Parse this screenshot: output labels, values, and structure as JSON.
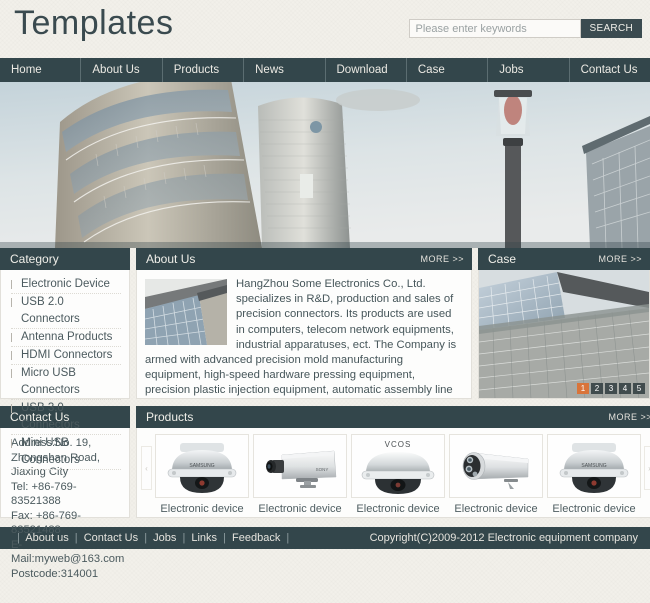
{
  "header": {
    "title": "Templates",
    "search": {
      "placeholder": "Please enter keywords",
      "value": "",
      "button_label": "SEARCH",
      "icon": "search-icon"
    }
  },
  "nav": {
    "items": [
      {
        "label": "Home"
      },
      {
        "label": "About Us"
      },
      {
        "label": "Products"
      },
      {
        "label": "News"
      },
      {
        "label": "Download"
      },
      {
        "label": "Case"
      },
      {
        "label": "Jobs"
      },
      {
        "label": "Contact Us"
      }
    ]
  },
  "banner": {
    "alt": "city-buildings-with-street-lamp-banner"
  },
  "category": {
    "title": "Category",
    "items": [
      {
        "label": "Electronic Device"
      },
      {
        "label": "USB 2.0 Connectors"
      },
      {
        "label": "Antenna Products"
      },
      {
        "label": "HDMI Connectors"
      },
      {
        "label": "Micro USB Connectors"
      },
      {
        "label": "USB 3.0 Connectors"
      },
      {
        "label": "Mini USB Connectors"
      }
    ]
  },
  "about": {
    "title": "About Us",
    "more_label": "MORE >>",
    "thumb_alt": "building-facade-photo",
    "text": "HangZhou Some Electronics Co., Ltd. specializes in R&D, production and sales of precision connectors. Its products are used in computers, telecom network equipments, industrial apparatuses, ect. The Company is armed with advanced precision mold manufacturing equipment, high-speed hardware pressing equipment, precision plastic injection equipment, automatic assembly line and inspection/testing devices.The company adheres to the business principle of technology plastic injection equipment, automatic assembly line"
  },
  "case": {
    "title": "Case",
    "more_label": "MORE >>",
    "image_alt": "office-tower-glass-facade-photo",
    "pager": [
      {
        "label": "1",
        "active": true
      },
      {
        "label": "2",
        "active": false
      },
      {
        "label": "3",
        "active": false
      },
      {
        "label": "4",
        "active": false
      },
      {
        "label": "5",
        "active": false
      }
    ],
    "active_color": "#d9743a"
  },
  "contact": {
    "title": "Contact Us",
    "lines": [
      "Address:No. 19, Zhongshan Road, Jiaxing City",
      "Tel: +86-769-83521388",
      "Fax: +86-769-83521488",
      "E-Mail:myweb@163.com",
      "Postcode:314001"
    ]
  },
  "products": {
    "title": "Products",
    "more_label": "MORE >>",
    "prev_label": "‹",
    "next_label": "›",
    "items": [
      {
        "label": "Electronic device",
        "image": "dome-camera"
      },
      {
        "label": "Electronic device",
        "image": "box-camera"
      },
      {
        "label": "Electronic device",
        "image": "dome-camera-vcos"
      },
      {
        "label": "Electronic device",
        "image": "bullet-ir-camera"
      },
      {
        "label": "Electronic device",
        "image": "dome-camera"
      }
    ]
  },
  "footer": {
    "links": [
      {
        "label": "About us"
      },
      {
        "label": "Contact Us"
      },
      {
        "label": "Jobs"
      },
      {
        "label": "Links"
      },
      {
        "label": "Feedback"
      }
    ],
    "separator": "|",
    "copyright": "Copyright(C)2009-2012 Electronic equipment company"
  },
  "colors": {
    "dark": "#33464b",
    "page_bg": "#f2f0ea",
    "accent": "#d9743a"
  }
}
